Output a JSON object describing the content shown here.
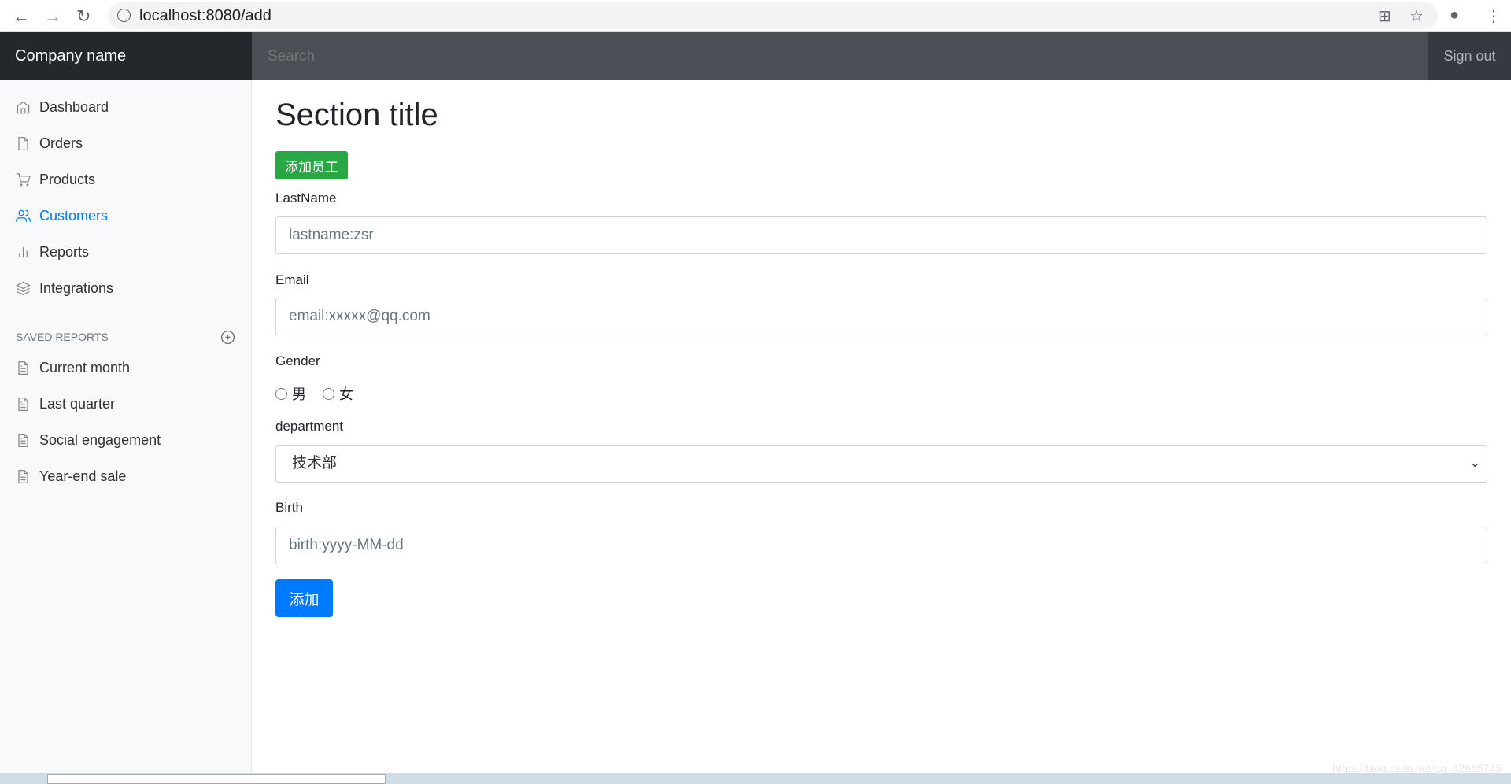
{
  "browser": {
    "url": "localhost:8080/add"
  },
  "navbar": {
    "brand": "Company name",
    "search_placeholder": "Search",
    "signout": "Sign out"
  },
  "sidebar": {
    "items": [
      {
        "label": "Dashboard",
        "icon": "home-icon"
      },
      {
        "label": "Orders",
        "icon": "file-icon"
      },
      {
        "label": "Products",
        "icon": "shopping-cart-icon"
      },
      {
        "label": "Customers",
        "icon": "users-icon",
        "active": true
      },
      {
        "label": "Reports",
        "icon": "bar-chart-icon"
      },
      {
        "label": "Integrations",
        "icon": "layers-icon"
      }
    ],
    "saved_heading": "SAVED REPORTS",
    "saved": [
      {
        "label": "Current month"
      },
      {
        "label": "Last quarter"
      },
      {
        "label": "Social engagement"
      },
      {
        "label": "Year-end sale"
      }
    ]
  },
  "main": {
    "title": "Section title",
    "add_employee_button": "添加员工",
    "form": {
      "lastname_label": "LastName",
      "lastname_placeholder": "lastname:zsr",
      "email_label": "Email",
      "email_placeholder": "email:xxxxx@qq.com",
      "gender_label": "Gender",
      "gender_options": [
        "男",
        "女"
      ],
      "department_label": "department",
      "department_value": "技术部",
      "birth_label": "Birth",
      "birth_placeholder": "birth:yyyy-MM-dd",
      "submit": "添加"
    }
  },
  "watermark": "https://blog.csdn.net/qq_42665745",
  "colors": {
    "accent": "#007bff",
    "success": "#28a745",
    "navbar": "#343a40"
  }
}
